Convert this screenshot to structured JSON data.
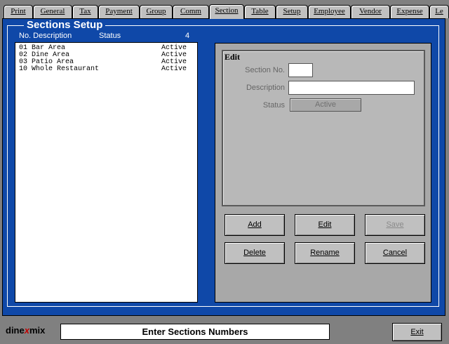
{
  "tabs": [
    {
      "label": "Print"
    },
    {
      "label": "General"
    },
    {
      "label": "Tax"
    },
    {
      "label": "Payment"
    },
    {
      "label": "Group"
    },
    {
      "label": "Comm"
    },
    {
      "label": "Section"
    },
    {
      "label": "Table"
    },
    {
      "label": "Setup"
    },
    {
      "label": "Employee"
    },
    {
      "label": "Vendor"
    },
    {
      "label": "Expense"
    },
    {
      "label": "Le"
    }
  ],
  "panel": {
    "title": "Sections Setup",
    "col_no_desc": "No. Description",
    "col_status": "Status",
    "count": "4"
  },
  "sections": [
    {
      "no": "01",
      "description": "Bar Area",
      "status": "Active"
    },
    {
      "no": "02",
      "description": "Dine Area",
      "status": "Active"
    },
    {
      "no": "03",
      "description": "Patio Area",
      "status": "Active"
    },
    {
      "no": "10",
      "description": "Whole Restaurant",
      "status": "Active"
    }
  ],
  "edit": {
    "title": "Edit",
    "section_no_label": "Section No.",
    "section_no_value": "",
    "description_label": "Description",
    "description_value": "",
    "status_label": "Status",
    "status_value": "Active"
  },
  "buttons": {
    "add": "Add",
    "edit": "Edit",
    "save": "Save",
    "delete": "Delete",
    "rename": "Rename",
    "cancel": "Cancel"
  },
  "footer": {
    "logo_left": "dine",
    "logo_mid": "x",
    "logo_right": "mix",
    "prompt": "Enter Sections Numbers",
    "exit": "Exit"
  }
}
